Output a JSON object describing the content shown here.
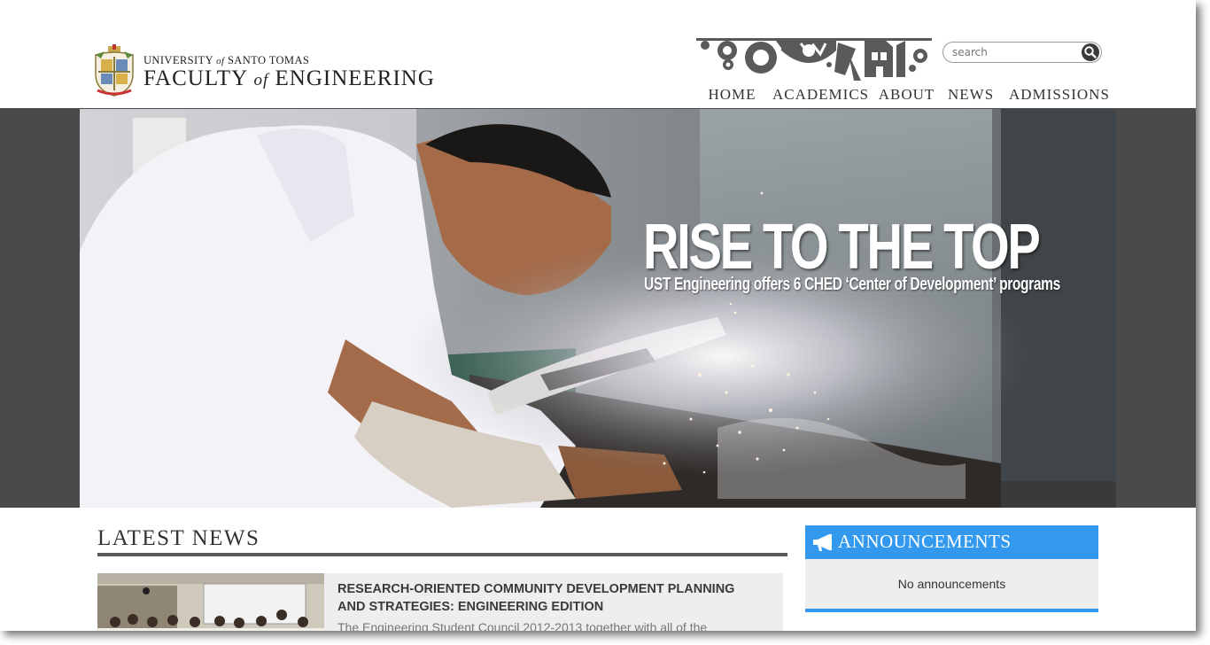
{
  "header": {
    "logo": {
      "line1_prefix": "UNIVERSITY",
      "line1_of": "of",
      "line1_suffix": "SANTO TOMAS",
      "line2_prefix": "FACULTY",
      "line2_of": "of",
      "line2_suffix": "ENGINEERING"
    },
    "search": {
      "placeholder": "search"
    },
    "nav": [
      {
        "label": "HOME",
        "active": true
      },
      {
        "label": "ACADEMICS",
        "active": false
      },
      {
        "label": "ABOUT",
        "active": false
      },
      {
        "label": "NEWS",
        "active": false
      },
      {
        "label": "ADMISSIONS",
        "active": false
      }
    ]
  },
  "hero": {
    "title": "RISE TO THE TOP",
    "subtitle": "UST Engineering offers 6 CHED ‘Center of Development’ programs"
  },
  "latest_news": {
    "heading": "LATEST NEWS",
    "items": [
      {
        "title": "RESEARCH-ORIENTED COMMUNITY DEVELOPMENT PLANNING AND STRATEGIES: ENGINEERING EDITION",
        "excerpt": "The Engineering Student Council 2012-2013 together with all of the"
      }
    ]
  },
  "announcements": {
    "heading": "ANNOUNCEMENTS",
    "empty_text": "No announcements"
  },
  "colors": {
    "accent_blue": "#3399ee",
    "nav_underline": "#3a3a3a",
    "hero_frame": "#4a4a4a"
  },
  "icons": [
    "crest-logo",
    "gears-banner-icon",
    "search-icon",
    "megaphone-icon"
  ]
}
